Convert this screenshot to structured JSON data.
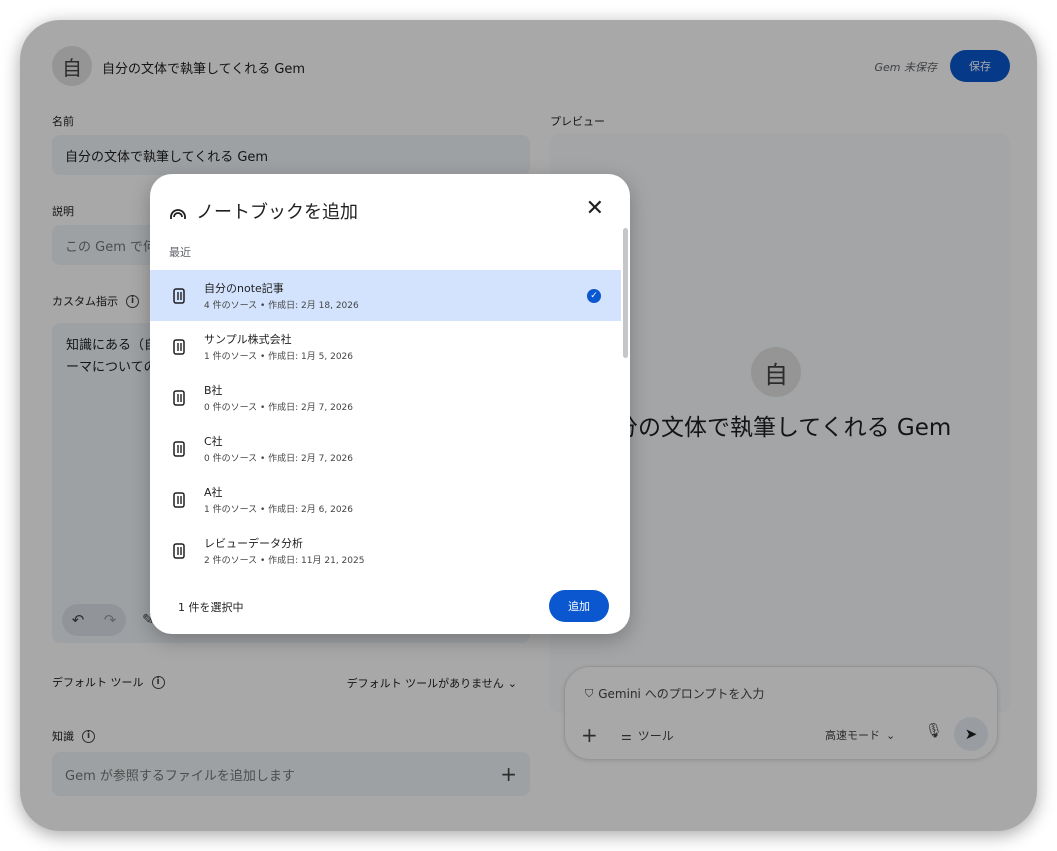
{
  "header": {
    "avatar_letter": "自",
    "title": "自分の文体で執筆してくれる Gem",
    "status": "Gem 未保存",
    "save_label": "保存"
  },
  "form": {
    "name_label": "名前",
    "name_value": "自分の文体で執筆してくれる Gem",
    "desc_label": "説明",
    "desc_placeholder": "この Gem で何",
    "instr_label": "カスタム指示",
    "instr_lines": [
      "知識にある（自",
      "ーマについての"
    ],
    "default_tools_label": "デフォルト ツール",
    "default_tools_value": "デフォルト ツールがありません",
    "knowledge_label": "知識",
    "knowledge_placeholder": "Gem が参照するファイルを追加します"
  },
  "preview": {
    "label": "プレビュー",
    "avatar_letter": "自",
    "title": "分の文体で執筆してくれる Gem"
  },
  "prompt": {
    "placeholder": "Gemini へのプロンプトを入力",
    "tools_label": "ツール",
    "mode_label": "高速モード"
  },
  "modal": {
    "title": "ノートブックを追加",
    "section": "最近",
    "items": [
      {
        "title": "自分のnote記事",
        "sub": "4 件のソース • 作成日: 2月 18, 2026"
      },
      {
        "title": "サンプル株式会社",
        "sub": "1 件のソース • 作成日: 1月 5, 2026"
      },
      {
        "title": "B社",
        "sub": "0 件のソース • 作成日: 2月 7, 2026"
      },
      {
        "title": "C社",
        "sub": "0 件のソース • 作成日: 2月 7, 2026"
      },
      {
        "title": "A社",
        "sub": "1 件のソース • 作成日: 2月 6, 2026"
      },
      {
        "title": "レビューデータ分析",
        "sub": "2 件のソース • 作成日: 11月 21, 2025"
      }
    ],
    "selected_count": "1 件を選択中",
    "add_label": "追加"
  },
  "colors": {
    "accent": "#0b57d0",
    "selected_row": "#d3e3fd",
    "field_bg": "#f0f4f9"
  }
}
